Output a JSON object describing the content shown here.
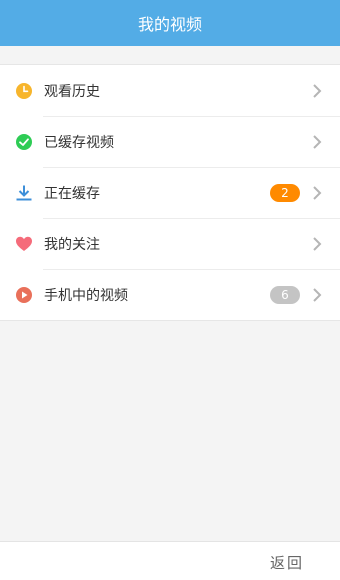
{
  "header": {
    "title": "我的视频"
  },
  "menu": {
    "items": [
      {
        "label": "观看历史",
        "icon": "clock-icon"
      },
      {
        "label": "已缓存视频",
        "icon": "check-circle-icon"
      },
      {
        "label": "正在缓存",
        "icon": "download-icon",
        "badge": "2",
        "badge_color": "#ff8a00"
      },
      {
        "label": "我的关注",
        "icon": "heart-icon"
      },
      {
        "label": "手机中的视频",
        "icon": "play-circle-icon",
        "badge": "6",
        "badge_color": "#c4c4c4"
      }
    ]
  },
  "footer": {
    "back_label": "返回"
  },
  "colors": {
    "header_bg": "#53ace6",
    "clock": "#f7b52c",
    "check": "#2ecc55",
    "download": "#3d8fd9",
    "heart": "#f56b7a",
    "play": "#e9705a"
  }
}
